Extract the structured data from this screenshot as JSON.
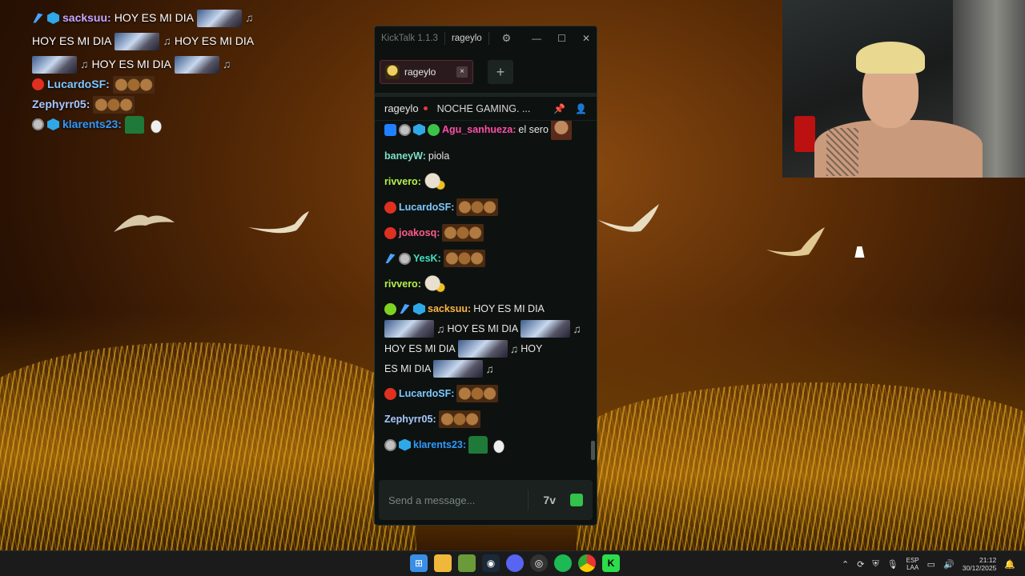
{
  "overlay_chat": {
    "lines": [
      {
        "user": "sacksuu:",
        "text1": "HOY ES MI DIA",
        "text2": "HOY ES MI DIA",
        "text3": "HOY ES MI DIA",
        "text4": "HOY ES MI DIA",
        "note": "♫",
        "color": "#c9a6ff"
      },
      {
        "user": "LucardoSF:",
        "color": "#7fc8ff"
      },
      {
        "user": "Zephyrr05:",
        "color": "#a8c8ff"
      },
      {
        "user": "klarents23:",
        "color": "#2f9bff"
      }
    ]
  },
  "kicktalk": {
    "app_title": "KickTalk 1.1.3",
    "channel_title": "rageylo",
    "tab_label": "rageylo",
    "tab_close": "×",
    "add_tab": "+",
    "channel_name": "rageylo",
    "stream_title": "NOCHE GAMING. ...",
    "input_placeholder": "Send a message...",
    "input_btn_7tv": "7v",
    "messages": [
      {
        "user": "Agu_sanhueza:",
        "text": "el sero",
        "color": "#ff4da6"
      },
      {
        "user": "baneyW:",
        "text": "piola",
        "color": "#7fe0c8"
      },
      {
        "user": "rivvero:",
        "text": "",
        "color": "#b8f04a"
      },
      {
        "user": "LucardoSF:",
        "text": "",
        "color": "#7fc8ff"
      },
      {
        "user": "joakosq:",
        "text": "",
        "color": "#ff5a8a"
      },
      {
        "user": "YesK:",
        "text": "",
        "color": "#41e0c0"
      },
      {
        "user": "rivvero:",
        "text": "",
        "color": "#b8f04a"
      },
      {
        "user": "sacksuu:",
        "text": "HOY ES MI DIA",
        "text2": "HOY ES MI DIA",
        "text3": "HOY ES MI DIA",
        "text4": "HOY",
        "text5": "ES MI DIA",
        "note": "♫",
        "color": "#ffb347"
      },
      {
        "user": "LucardoSF:",
        "text": "",
        "color": "#7fc8ff"
      },
      {
        "user": "Zephyrr05:",
        "text": "",
        "color": "#a8c8ff"
      },
      {
        "user": "klarents23:",
        "text": "",
        "color": "#2f9bff"
      }
    ]
  },
  "taskbar": {
    "lang_top": "ESP",
    "lang_bottom": "LAA",
    "time": "21:12",
    "date": "30/12/2025"
  }
}
